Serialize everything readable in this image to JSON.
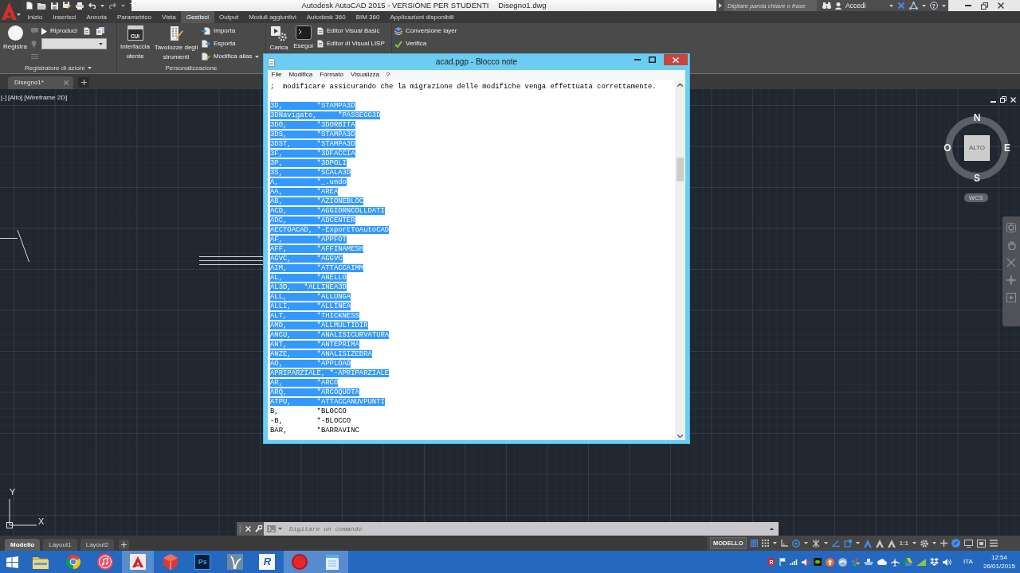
{
  "title_bar": {
    "title": "Autodesk AutoCAD 2015 - VERSIONE PER STUDENTI",
    "file": "Disegno1.dwg",
    "search": {
      "placeholder": "Digitare parola chiave o frase"
    },
    "sign_in": "Accedi",
    "help": "?"
  },
  "ribbon": {
    "tabs": [
      {
        "label": "Inizio",
        "selected": false
      },
      {
        "label": "Inserisci",
        "selected": false
      },
      {
        "label": "Annota",
        "selected": false
      },
      {
        "label": "Parametrico",
        "selected": false
      },
      {
        "label": "Vista",
        "selected": false
      },
      {
        "label": "Gestisci",
        "selected": true
      },
      {
        "label": "Output",
        "selected": false
      },
      {
        "label": "Moduli aggiuntivi",
        "selected": false
      },
      {
        "label": "Autodesk 360",
        "selected": false
      },
      {
        "label": "BIM 360",
        "selected": false
      },
      {
        "label": "Applicazioni disponibili",
        "selected": false
      }
    ],
    "panels": [
      {
        "title": "Registratore di azioni",
        "menu": true,
        "columns": [
          {
            "kind": "large",
            "label": "Registra",
            "disabled": false
          },
          {
            "kind": "stack",
            "rows": [
              [
                {
                  "kind": "tool",
                  "disabled": true
                }
              ],
              [
                {
                  "kind": "tool",
                  "disabled": true
                }
              ],
              [
                {
                  "kind": "tool",
                  "disabled": true
                }
              ]
            ]
          },
          {
            "kind": "stack",
            "rows": [
              [
                {
                  "kind": "tool",
                  "label": "Riproduci",
                  "disabled": false
                },
                {
                  "kind": "tool",
                  "disabled": false
                },
                {
                  "kind": "tool",
                  "disabled": false
                }
              ],
              [
                {
                  "kind": "combo",
                  "disabled": false
                }
              ]
            ]
          }
        ]
      },
      {
        "title": "Personalizzazione",
        "columns": [
          {
            "kind": "large",
            "label": "Interfaccia utente",
            "icon_text": "CUI",
            "disabled": false
          },
          {
            "kind": "large",
            "label": "Tavolozze degli strumenti",
            "disabled": false
          },
          {
            "kind": "stack",
            "rows": [
              [
                {
                  "kind": "tool",
                  "label": "Importa",
                  "disabled": false
                }
              ],
              [
                {
                  "kind": "tool",
                  "label": "Esporta",
                  "disabled": false
                }
              ],
              [
                {
                  "kind": "tool",
                  "label": "Modifica alias",
                  "menu": true,
                  "disabled": false
                }
              ]
            ]
          }
        ]
      },
      {
        "columns": [
          {
            "kind": "large",
            "label": "Carica",
            "disabled": false
          },
          {
            "kind": "large",
            "label": "Esegui",
            "disabled": false
          },
          {
            "kind": "stack",
            "rows": [
              [
                {
                  "kind": "tool",
                  "label": "Editor Visual Basic",
                  "disabled": false
                }
              ],
              [
                {
                  "kind": "tool",
                  "label": "Editor di Visual LISP",
                  "disabled": false
                }
              ]
            ]
          }
        ]
      },
      {
        "columns": [
          {
            "kind": "stack",
            "rows": [
              [
                {
                  "kind": "tool",
                  "label": "Conversione layer",
                  "disabled": false
                }
              ],
              [
                {
                  "kind": "tool",
                  "label": "Verifica",
                  "disabled": false
                }
              ]
            ]
          }
        ]
      }
    ]
  },
  "file_tabs": [
    {
      "label": "Disegno1*",
      "selected": true
    }
  ],
  "viewport": {
    "controls": [
      "[-]",
      "[Alto]",
      "[Wireframe 2D]"
    ],
    "view_cube": {
      "face": "ALTO",
      "north": "N",
      "east": "E",
      "south": "S",
      "west": "O",
      "ucs": "WCS"
    },
    "axes": {
      "x": "X",
      "y": "Y"
    }
  },
  "notepad": {
    "title": "acad.pgp - Blocco note",
    "menu": [
      "File",
      "Modifica",
      "Formato",
      "Visualizza",
      "?"
    ],
    "comment": ";  modificare assicurando che la migrazione delle modifiche venga effettuata correttamente.",
    "lines": [
      {
        "text": "3D,        *STAMPA3D",
        "selected": true
      },
      {
        "text": "3DNavigate,     *PASSEGG3D",
        "selected": true
      },
      {
        "text": "3DO,       *3DORBITA",
        "selected": true
      },
      {
        "text": "3DS,       *STAMPA3D",
        "selected": true
      },
      {
        "text": "3DST,      *STAMPA3D",
        "selected": true
      },
      {
        "text": "3F,        *3DFACCIA",
        "selected": true
      },
      {
        "text": "3P,        *3DPOLI",
        "selected": true
      },
      {
        "text": "3S,        *SCALA3D",
        "selected": true
      },
      {
        "text": "A,         *_.undo",
        "selected": true
      },
      {
        "text": "AA,        *AREA",
        "selected": true
      },
      {
        "text": "AB,        *AZIONEBLOC",
        "selected": true
      },
      {
        "text": "ACD,       *AGGIORNCOLLDATI",
        "selected": true
      },
      {
        "text": "ADC,       *ADCENTER",
        "selected": true
      },
      {
        "text": "AECTOACAD, *-ExportToAutoCAD",
        "selected": true
      },
      {
        "text": "AF,        *APPFOT",
        "selected": true
      },
      {
        "text": "AFF,       *AFFINAMESH",
        "selected": true
      },
      {
        "text": "AGVC,      *AGGVC",
        "selected": true
      },
      {
        "text": "AIM,       *ATTACCAIMM",
        "selected": true
      },
      {
        "text": "AL,        *ANELLO",
        "selected": true
      },
      {
        "text": "AL3D,   *ALLINEA3D",
        "selected": true
      },
      {
        "text": "ALL,       *ALLUNGA",
        "selected": true
      },
      {
        "text": "ALLI,      *ALLINEA",
        "selected": true
      },
      {
        "text": "ALT,       *THICKNESS",
        "selected": true
      },
      {
        "text": "AMD,       *ALLMULTIDIR",
        "selected": true
      },
      {
        "text": "ANCU,      *ANALISICURVATURA",
        "selected": true
      },
      {
        "text": "ANT,       *ANTEPRIMA",
        "selected": true
      },
      {
        "text": "ANZE,      *ANALISIZEBRA",
        "selected": true
      },
      {
        "text": "AO,        *APPLOAD",
        "selected": true
      },
      {
        "text": "APRIPARZIALE, *-APRIPARZIALE",
        "selected": true
      },
      {
        "text": "AR,        *ARCO",
        "selected": true
      },
      {
        "text": "ARQ,       *ARCOQUOTA",
        "selected": true
      },
      {
        "text": "ATPU,      *ATTACCANUVPUNTI",
        "selected": true
      },
      {
        "text": "B,         *BLOCCO",
        "selected": false
      },
      {
        "text": "-B,        *-BLOCCO",
        "selected": false
      },
      {
        "text": "BAR,       *BARRAVINC",
        "selected": false
      }
    ]
  },
  "command_line": {
    "placeholder": "Digitare un comando"
  },
  "layout_tabs": [
    {
      "label": "Modello",
      "selected": true
    },
    {
      "label": "Layout1",
      "selected": false
    },
    {
      "label": "Layout2",
      "selected": false
    }
  ],
  "status_bar": {
    "space": "MODELLO",
    "tools": [
      {
        "kind": "grid",
        "on": true
      },
      {
        "kind": "snap",
        "on": false,
        "menu": true
      },
      {
        "kind": "infer",
        "on": false
      },
      {
        "kind": "polar",
        "on": true,
        "menu": true
      },
      {
        "kind": "isodraft",
        "on": false,
        "menu": true
      },
      {
        "kind": "tracking",
        "on": true
      },
      {
        "kind": "osnap",
        "on": true,
        "menu": true
      },
      {
        "kind": "annovisibility",
        "on": true
      },
      {
        "kind": "autoscale",
        "on": false
      },
      {
        "kind": "annoscale",
        "on": false
      },
      {
        "kind": "scale",
        "label": "1:1",
        "on": false,
        "menu": true
      },
      {
        "kind": "workspace",
        "on": false,
        "menu": true
      },
      {
        "kind": "plus",
        "on": false
      },
      {
        "kind": "isolate",
        "on": true
      },
      {
        "kind": "hardware",
        "on": false
      },
      {
        "kind": "cleanscreen",
        "on": false
      },
      {
        "kind": "customize",
        "on": false
      }
    ]
  },
  "taskbar": {
    "apps": [
      {
        "kind": "folder",
        "active": false
      },
      {
        "kind": "browser",
        "active": false
      },
      {
        "kind": "music",
        "active": false
      },
      {
        "kind": "cad",
        "active": true
      },
      {
        "kind": "sketch",
        "active": false
      },
      {
        "kind": "photo",
        "label": "Ps",
        "active": false
      },
      {
        "kind": "plant",
        "active": false
      },
      {
        "kind": "bim",
        "label": "R",
        "active": false
      },
      {
        "kind": "record",
        "active": true
      },
      {
        "kind": "notepad",
        "active": true
      }
    ],
    "tray": [
      {
        "kind": "badge",
        "label": "R"
      },
      {
        "kind": "flag"
      },
      {
        "kind": "bars"
      },
      {
        "kind": "muted"
      },
      {
        "kind": "eye"
      },
      {
        "kind": "update"
      },
      {
        "kind": "swirl"
      },
      {
        "kind": "pinwheel"
      },
      {
        "kind": "ship"
      },
      {
        "kind": "cloud"
      },
      {
        "kind": "plane"
      },
      {
        "kind": "drive"
      },
      {
        "kind": "signal"
      },
      {
        "kind": "box"
      },
      {
        "kind": "speaker"
      }
    ],
    "language": "ITA",
    "time": "12:54",
    "date": "26/01/2015"
  }
}
